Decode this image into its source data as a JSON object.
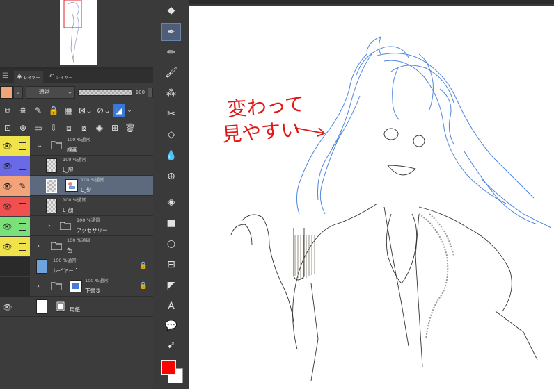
{
  "layer_panel": {
    "tabs": [
      {
        "label": "レイヤー",
        "icon": "layers-icon",
        "active": true
      },
      {
        "label": "レイヤー",
        "icon": "undo-history-icon",
        "active": false
      }
    ],
    "blend_mode": "通常",
    "opacity": "100",
    "layers": [
      {
        "meta": "100 %通常",
        "name": "線画",
        "type": "folder",
        "eye_color": "#f0e24a",
        "expanded": true
      },
      {
        "meta": "100 %通常",
        "name": "L_服",
        "type": "raster",
        "eye_color": "#6a6ae6"
      },
      {
        "meta": "100 %通常",
        "name": "L_髪",
        "type": "raster",
        "eye_color": "#f3a37a",
        "selected": true
      },
      {
        "meta": "100 %通常",
        "name": "L_顔",
        "type": "raster",
        "eye_color": "#f05050"
      },
      {
        "meta": "100 %通過",
        "name": "アクセサリー",
        "type": "folder",
        "eye_color": "#7ae07a"
      },
      {
        "meta": "100 %通過",
        "name": "色",
        "type": "folder",
        "eye_color": "#f0e24a"
      },
      {
        "meta": "100 %通常",
        "name": "レイヤー 1",
        "type": "raster",
        "eye_color": "#2a2a2a",
        "locked": true
      },
      {
        "meta": "100 %通常",
        "name": "下書き",
        "type": "folder",
        "eye_color": "#2a2a2a",
        "locked": true
      },
      {
        "meta": "",
        "name": "用紙",
        "type": "paper",
        "eye_color": "#3c3c3c"
      }
    ]
  },
  "tools": [
    "fill-bucket-icon",
    "pen-icon",
    "pencil-icon",
    "brush-icon",
    "airbrush-icon",
    "decoration-icon",
    "eraser-icon",
    "blend-icon",
    "figure-icon",
    "color-fill-icon",
    "gradient-icon",
    "ellipse-icon",
    "frame-icon",
    "ruler-icon",
    "text-icon",
    "balloon-icon",
    "correct-line-icon"
  ],
  "colors": {
    "foreground": "#ff0000",
    "background": "#ffffff"
  },
  "canvas": {
    "annotation_line1": "変わって",
    "annotation_line2": "見やすい"
  }
}
